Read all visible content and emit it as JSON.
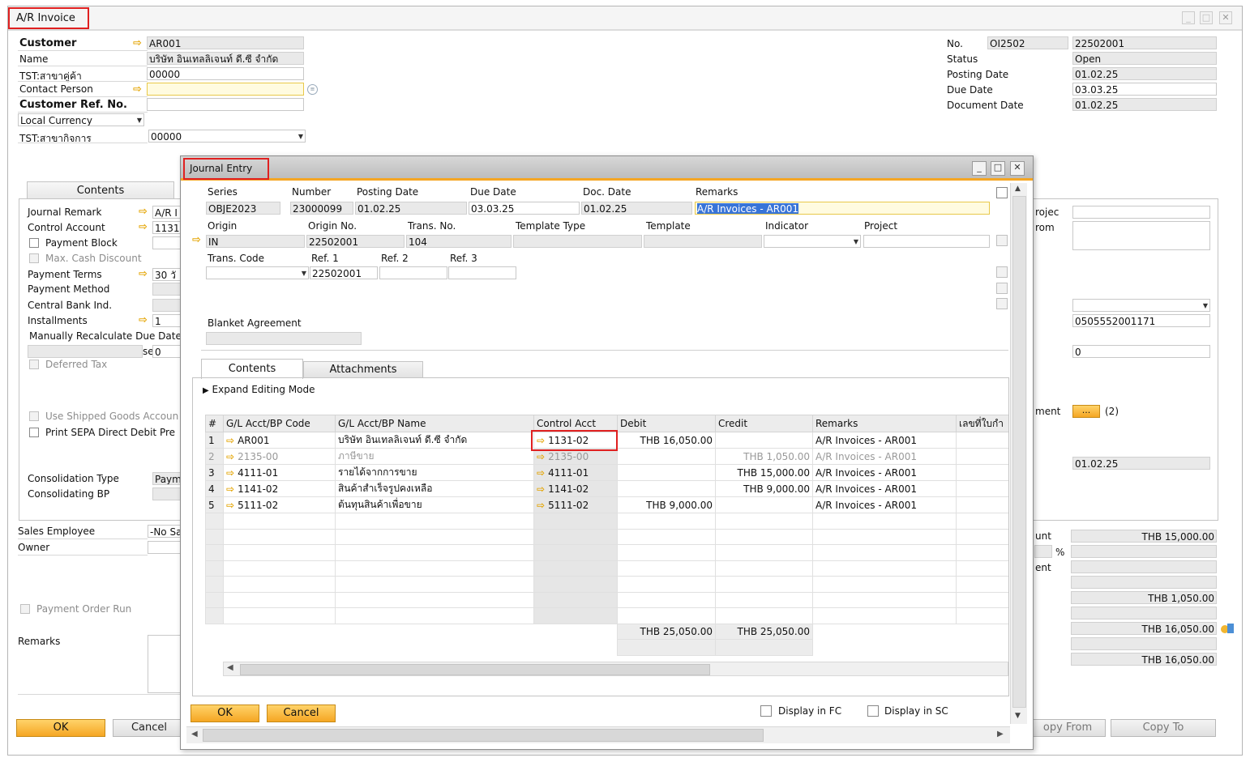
{
  "ar_window": {
    "title": "A/R Invoice",
    "customer": {
      "label": "Customer",
      "value": "AR001"
    },
    "name": {
      "label": "Name",
      "value": "บริษัท อินเทลลิเจนท์ ดี.ซี จำกัด"
    },
    "tst_partner": {
      "label": "TST:สาขาคู่ค้า",
      "value": "00000"
    },
    "contact_person": {
      "label": "Contact Person",
      "value": ""
    },
    "customer_ref": {
      "label": "Customer Ref. No.",
      "value": ""
    },
    "currency": {
      "value": "Local Currency"
    },
    "tst_branch": {
      "label": "TST:สาขากิจการ",
      "value": "00000"
    },
    "right": {
      "no": {
        "label": "No.",
        "series": "OI2502",
        "value": "22502001"
      },
      "status": {
        "label": "Status",
        "value": "Open"
      },
      "posting_date": {
        "label": "Posting Date",
        "value": "01.02.25"
      },
      "due_date": {
        "label": "Due Date",
        "value": "03.03.25"
      },
      "document_date": {
        "label": "Document Date",
        "value": "01.02.25"
      }
    },
    "tab_contents": "Contents",
    "left_panel": {
      "journal_remark": {
        "label": "Journal Remark",
        "value": "A/R I"
      },
      "control_account": {
        "label": "Control Account",
        "value": "1131"
      },
      "payment_block": "Payment Block",
      "max_cash_discount": "Max. Cash Discount",
      "payment_terms": {
        "label": "Payment Terms",
        "value": "30 วั"
      },
      "payment_method": "Payment Method",
      "central_bank": "Central Bank Ind.",
      "installments": {
        "label": "Installments",
        "value": "1"
      },
      "manually_recalc": "Manually Recalculate Due Date:",
      "recalc_suffix": "se",
      "recalc_value": "0",
      "deferred_tax": "Deferred Tax",
      "use_shipped": "Use Shipped Goods Accoun",
      "print_sepa": "Print SEPA Direct Debit Pre",
      "consolidation_type": {
        "label": "Consolidation Type",
        "value": "Paym"
      },
      "consolidating_bp": "Consolidating BP"
    },
    "right_panel": {
      "project_label": "rojec",
      "from_label": "rom",
      "field_number": "0505552001171",
      "field_zero": "0",
      "attachment_label": "ment",
      "attachment_btn": "...",
      "attachment_count": "(2)",
      "date_value": "01.02.25"
    },
    "bottom": {
      "sales_employee": {
        "label": "Sales Employee",
        "value": "-No Sa"
      },
      "owner": "Owner",
      "payment_order_run": "Payment Order Run",
      "remarks": "Remarks"
    },
    "totals": {
      "amount_label": "unt",
      "amount_value": "THB 15,000.00",
      "percent_sign": "%",
      "ent_label": "ent",
      "tax_value": "THB 1,050.00",
      "total_value": "THB 16,050.00",
      "balance_value": "THB 16,050.00"
    },
    "buttons": {
      "ok": "OK",
      "cancel": "Cancel",
      "copy_from": "opy From",
      "copy_to": "Copy To"
    }
  },
  "je_window": {
    "title": "Journal Entry",
    "header": {
      "series": {
        "label": "Series",
        "value": "OBJE2023"
      },
      "number": {
        "label": "Number",
        "value": "23000099"
      },
      "posting_date": {
        "label": "Posting Date",
        "value": "01.02.25"
      },
      "due_date": {
        "label": "Due Date",
        "value": "03.03.25"
      },
      "doc_date": {
        "label": "Doc. Date",
        "value": "01.02.25"
      },
      "remarks": {
        "label": "Remarks",
        "value": "A/R Invoices - AR001"
      },
      "origin": {
        "label": "Origin",
        "value": "IN"
      },
      "origin_no": {
        "label": "Origin No.",
        "value": "22502001"
      },
      "trans_no": {
        "label": "Trans. No.",
        "value": "104"
      },
      "template_type": {
        "label": "Template Type",
        "value": ""
      },
      "template": {
        "label": "Template",
        "value": ""
      },
      "indicator": {
        "label": "Indicator",
        "value": ""
      },
      "project": {
        "label": "Project",
        "value": ""
      },
      "trans_code": {
        "label": "Trans. Code",
        "value": ""
      },
      "ref1": {
        "label": "Ref. 1",
        "value": "22502001"
      },
      "ref2": {
        "label": "Ref. 2",
        "value": ""
      },
      "ref3": {
        "label": "Ref. 3",
        "value": ""
      },
      "blanket_agreement": {
        "label": "Blanket Agreement",
        "value": ""
      }
    },
    "tabs": {
      "contents": "Contents",
      "attachments": "Attachments"
    },
    "expand_editing_mode": "Expand Editing Mode",
    "grid": {
      "columns": [
        "#",
        "G/L Acct/BP Code",
        "G/L Acct/BP Name",
        "Control Acct",
        "Debit",
        "Credit",
        "Remarks",
        "เลขที่ใบกำ"
      ],
      "rows": [
        {
          "n": "1",
          "code": "AR001",
          "name": "บริษัท อินเทลลิเจนท์ ดี.ซี จำกัด",
          "ctrl": "1131-02",
          "debit": "THB 16,050.00",
          "credit": "",
          "remarks": "A/R Invoices - AR001"
        },
        {
          "n": "2",
          "code": "2135-00",
          "name": "ภาษีขาย",
          "ctrl": "2135-00",
          "debit": "",
          "credit": "THB 1,050.00",
          "remarks": "A/R Invoices - AR001"
        },
        {
          "n": "3",
          "code": "4111-01",
          "name": "รายได้จากการขาย",
          "ctrl": "4111-01",
          "debit": "",
          "credit": "THB 15,000.00",
          "remarks": "A/R Invoices - AR001"
        },
        {
          "n": "4",
          "code": "1141-02",
          "name": "สินค้าสำเร็จรูปคงเหลือ",
          "ctrl": "1141-02",
          "debit": "",
          "credit": "THB 9,000.00",
          "remarks": "A/R Invoices - AR001"
        },
        {
          "n": "5",
          "code": "5111-02",
          "name": "ต้นทุนสินค้าเพื่อขาย",
          "ctrl": "5111-02",
          "debit": "THB 9,000.00",
          "credit": "",
          "remarks": "A/R Invoices - AR001"
        }
      ],
      "total_debit": "THB 25,050.00",
      "total_credit": "THB 25,050.00"
    },
    "buttons": {
      "ok": "OK",
      "cancel": "Cancel"
    },
    "display_fc": "Display in FC",
    "display_sc": "Display in SC"
  },
  "colors": {
    "accent": "#f5a623",
    "highlight": "#e02020",
    "selection": "#3874d8"
  }
}
